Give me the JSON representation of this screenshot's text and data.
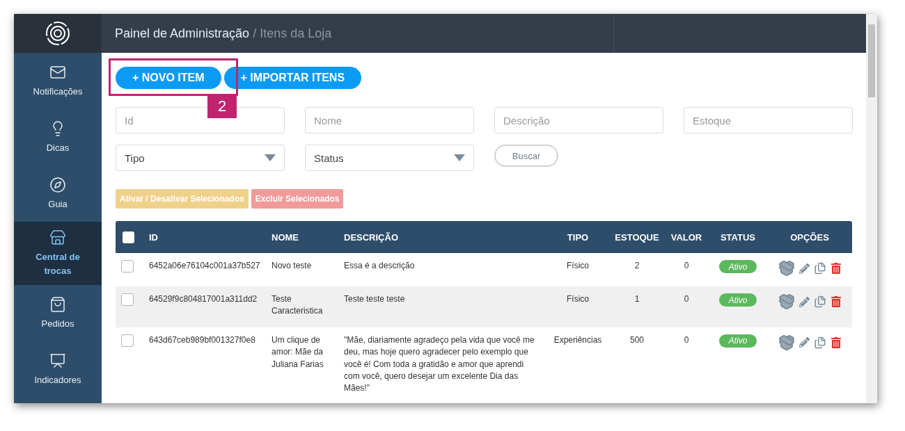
{
  "sidebar": {
    "items": [
      {
        "label": "Notificações",
        "selected": false
      },
      {
        "label": "Dicas",
        "selected": false
      },
      {
        "label": "Guia",
        "selected": false
      },
      {
        "label": "Central de trocas",
        "selected": true
      },
      {
        "label": "Pedidos",
        "selected": false
      },
      {
        "label": "Indicadores",
        "selected": false
      }
    ]
  },
  "header": {
    "title": "Painel de Administração",
    "subtitle": "/ Itens da Loja"
  },
  "actions": [
    "+ NOVO ITEM",
    "+ IMPORTAR ITENS"
  ],
  "callout": {
    "label": "2"
  },
  "filters": {
    "fields": [
      {
        "kind": "input",
        "placeholder": "Id"
      },
      {
        "kind": "input",
        "placeholder": "Nome"
      },
      {
        "kind": "input",
        "placeholder": "Descrição"
      },
      {
        "kind": "input",
        "placeholder": "Estoque"
      },
      {
        "kind": "select",
        "value": "Tipo"
      },
      {
        "kind": "select",
        "value": "Status"
      }
    ],
    "search_button": "Buscar"
  },
  "bulk_buttons": [
    {
      "label": "Ativar / Desativar Selecionados",
      "color": "#f0d18a"
    },
    {
      "label": "Excluir Selecionados",
      "color": "#f29a9a"
    }
  ],
  "table": {
    "select_all_checked": false,
    "columns": [
      "ID",
      "NOME",
      "DESCRIÇÃO",
      "TIPO",
      "ESTOQUE",
      "VALOR",
      "STATUS",
      "OPÇÕES"
    ],
    "rows": [
      {
        "checked": false,
        "id": "6452a06e76104c001a37b527",
        "name": "Novo teste",
        "description": "Essa é a descrição",
        "type": "Físico",
        "stock": "2",
        "value": "0",
        "status": "Ativo"
      },
      {
        "checked": false,
        "id": "64529f9c804817001a311dd2",
        "name": "Teste Caracteristica",
        "description": "Teste teste teste",
        "type": "Físico",
        "stock": "1",
        "value": "0",
        "status": "Ativo"
      },
      {
        "checked": false,
        "id": "643d67ceb989bf001327f0e8",
        "name": "Um clique de amor: Mãe da Juliana Farias",
        "description": "\"Mãe, diariamente agradeço pela vida que você me deu, mas hoje quero agradecer pelo exemplo que você é! Com toda a gratidão e amor que aprendi com você, quero desejar um excelente Dia das Mães!\"",
        "type": "Experiências",
        "stock": "500",
        "value": "0",
        "status": "Ativo"
      }
    ]
  }
}
